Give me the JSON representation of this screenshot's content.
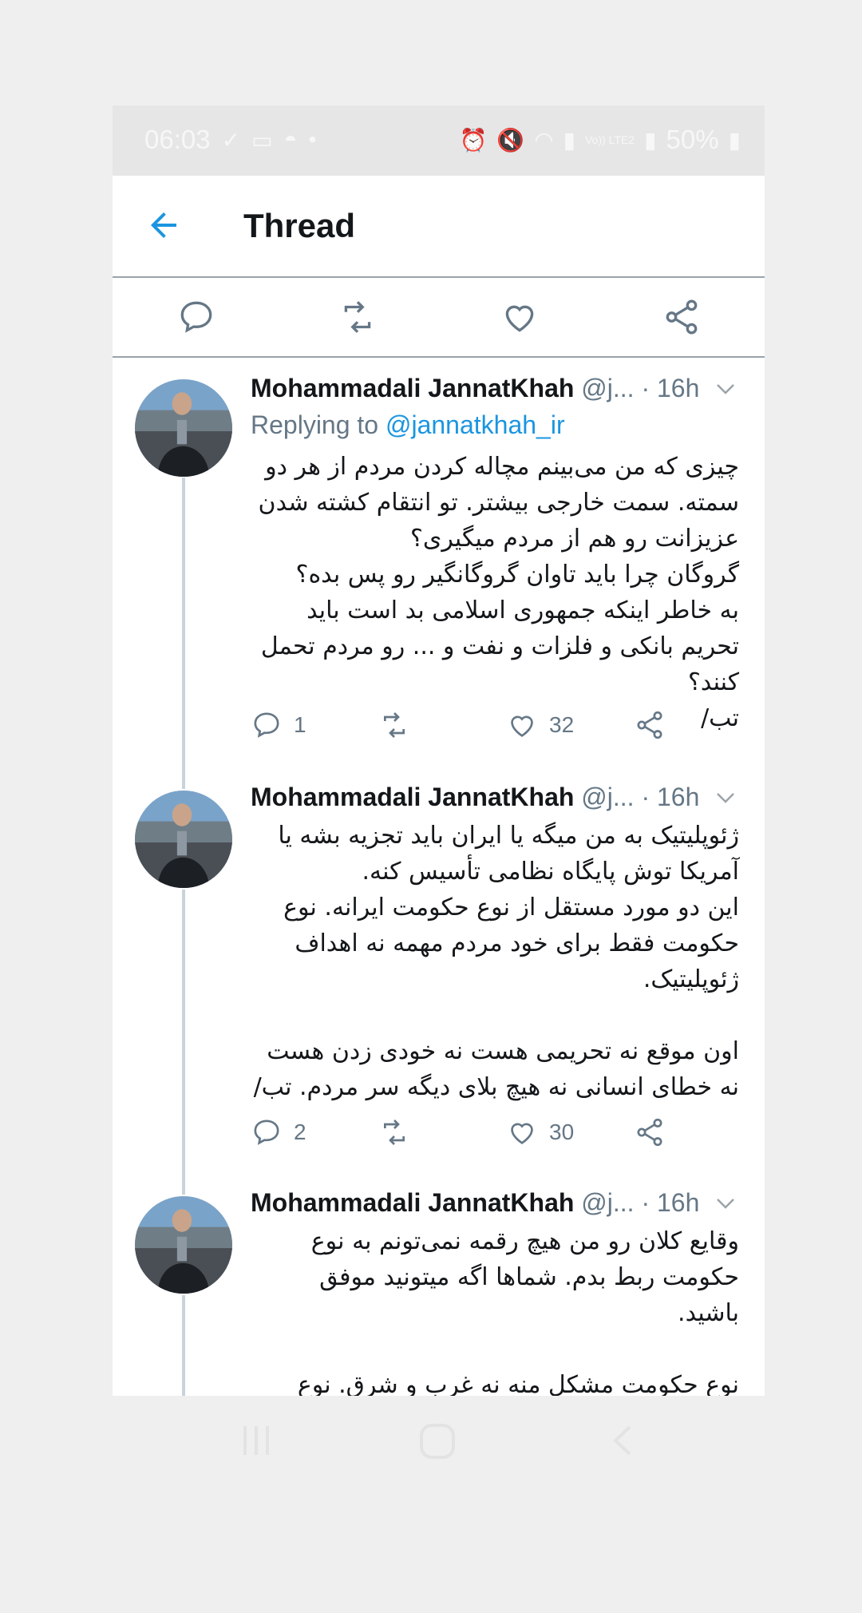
{
  "status_bar": {
    "time": "06:03",
    "network": "Vo)) LTE2",
    "battery": "50%"
  },
  "header": {
    "title": "Thread"
  },
  "colors": {
    "accent": "#1b95e0",
    "text": "#14171a",
    "muted": "#657786",
    "divider": "#9aa3a9",
    "thread_line": "#c8d3da"
  },
  "tweets": [
    {
      "name": "Mohammadali JannatKhah",
      "handle": "@j...",
      "time": "· 16h",
      "replying_prefix": "Replying to",
      "replying_handle": "@jannatkhah_ir",
      "text": "چیزی که من می‌بینم مچاله کردن مردم از هر دو سمته. سمت خارجی بیشتر. تو انتقام کشته شدن عزیزانت رو هم از مردم میگیری؟\nگروگان چرا باید تاوان گروگانگیر رو پس بده؟\nبه خاطر اینکه جمهوری اسلامی بد است باید تحریم بانکی و فلزات و نفت و ... رو مردم تحمل کنند؟\nتب/",
      "replies": "1",
      "retweets": "",
      "likes": "32"
    },
    {
      "name": "Mohammadali JannatKhah",
      "handle": "@j...",
      "time": "· 16h",
      "text": "ژئوپلیتیک به من میگه یا ایران باید تجزیه بشه یا آمریکا توش پایگاه نظامی تأسیس کنه.\nاین دو مورد مستقل از نوع حکومت ایرانه. نوع حکومت فقط برای خود مردم مهمه نه اهداف ژئوپلیتیک.\n\nاون موقع نه تحریمی هست نه خودی زدن هست نه خطای انسانی نه هیچ بلای دیگه سر مردم. تب/",
      "replies": "2",
      "retweets": "",
      "likes": "30"
    },
    {
      "name": "Mohammadali JannatKhah",
      "handle": "@j...",
      "time": "· 16h",
      "text": "وقایع کلان رو من هیچ رقمه نمی‌تونم به نوع حکومت ربط بدم. شماها اگه میتونید موفق باشید.\n\nنوع حکومت مشکل منه نه غرب و شرق. نوع حکومت به نحوه زندگی مردم ساکنش مربوطه که"
    }
  ]
}
